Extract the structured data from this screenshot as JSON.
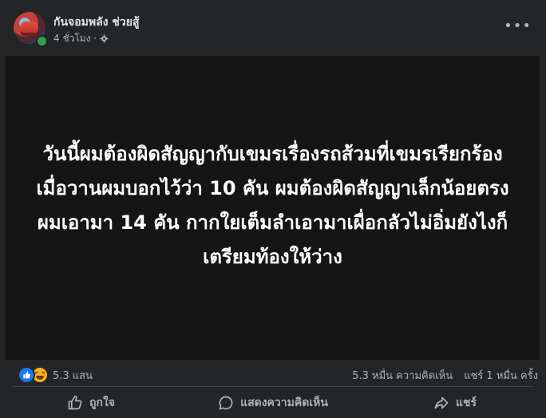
{
  "post": {
    "author": "กันจอมพลัง ช่วยสู้",
    "time": "4 ชั่วโมง ·",
    "more_label": "•••",
    "text": "วันนี้ผมต้องผิดสัญญากับเขมรเรื่องรถส้วมที่เขมรเรียกร้องเมื่อวานผมบอกไว้ว่า 10 คัน ผมต้องผิดสัญญาเล็กน้อยตรงผมเอามา 14 คัน กากใยเต็มลำเอามาเผื่อกลัวไม่อิ่มยังไงก็เตรียมท้องให้ว่าง"
  },
  "stats": {
    "reactions": "5.3 แสน",
    "comments": "5.3 หมื่น ความคิดเห็น",
    "shares": "แชร์ 1 หมื่น ครั้ง"
  },
  "actions": {
    "like": "ถูกใจ",
    "comment": "แสดงความคิดเห็น",
    "share": "แชร์"
  },
  "colors": {
    "like_blue": "#1877f2",
    "online_green": "#31a24c",
    "post_bg": "#151516"
  }
}
